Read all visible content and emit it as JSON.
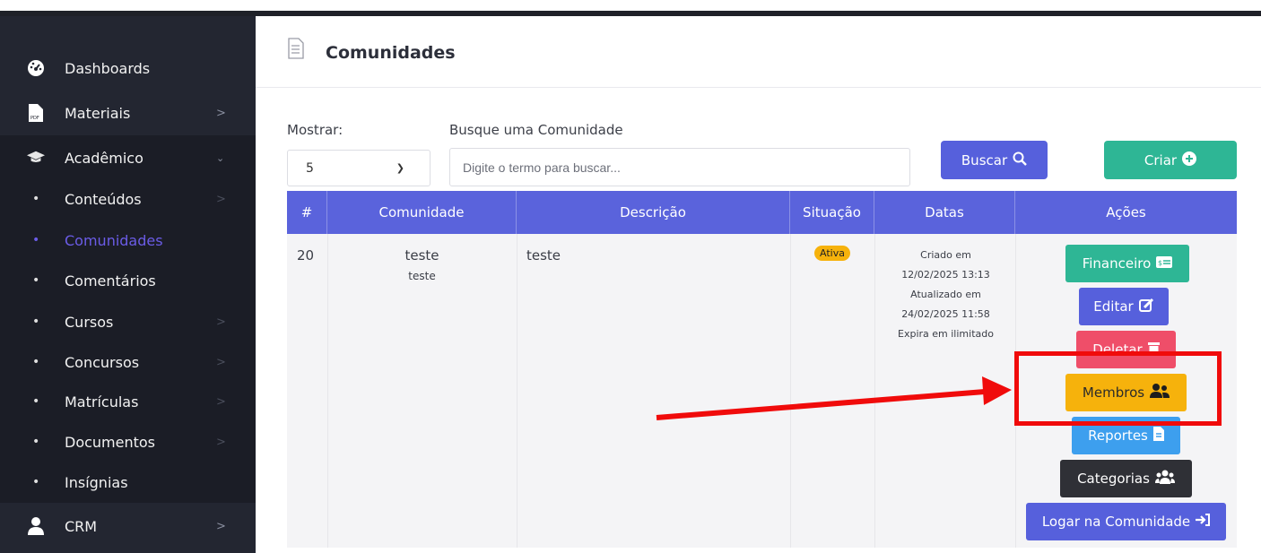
{
  "sidebar": {
    "items": [
      {
        "label": "Dashboards",
        "icon": "dashboard-icon"
      },
      {
        "label": "Materiais",
        "icon": "pdf-icon"
      },
      {
        "label": "Acadêmico",
        "icon": "graduation-cap-icon"
      },
      {
        "label": "Conteúdos"
      },
      {
        "label": "Comunidades"
      },
      {
        "label": "Comentários"
      },
      {
        "label": "Cursos"
      },
      {
        "label": "Concursos"
      },
      {
        "label": "Matrículas"
      },
      {
        "label": "Documentos"
      },
      {
        "label": "Insígnias"
      },
      {
        "label": "CRM",
        "icon": "user-icon"
      }
    ],
    "active_item": "Comunidades",
    "active_color": "#6b5ce7"
  },
  "header": {
    "title": "Comunidades"
  },
  "filters": {
    "show_label": "Mostrar:",
    "show_value": "5",
    "search_label": "Busque uma Comunidade",
    "search_placeholder": "Digite o termo para buscar...",
    "search_button": "Buscar",
    "create_button": "Criar"
  },
  "table": {
    "columns": [
      "#",
      "Comunidade",
      "Descrição",
      "Situação",
      "Datas",
      "Ações"
    ],
    "rows": [
      {
        "id": "20",
        "name": "teste",
        "subtitle": "teste",
        "description": "teste",
        "status": "Ativa",
        "dates": {
          "created_label": "Criado em",
          "created": "12/02/2025 13:13",
          "updated_label": "Atualizado em",
          "updated": "24/02/2025 11:58",
          "expires": "Expira em ilimitado"
        },
        "actions": {
          "financeiro": "Financeiro",
          "editar": "Editar",
          "deletar": "Deletar",
          "membros": "Membros",
          "reportes": "Reportes",
          "categorias": "Categorias",
          "logar": "Logar na Comunidade"
        }
      }
    ]
  },
  "colors": {
    "primary": "#5660dc",
    "success": "#2eb695",
    "danger": "#ef4e69",
    "warning": "#f6b20c",
    "info": "#3d9fee",
    "dark": "#2f3036",
    "annotation": "#f00b0b"
  }
}
